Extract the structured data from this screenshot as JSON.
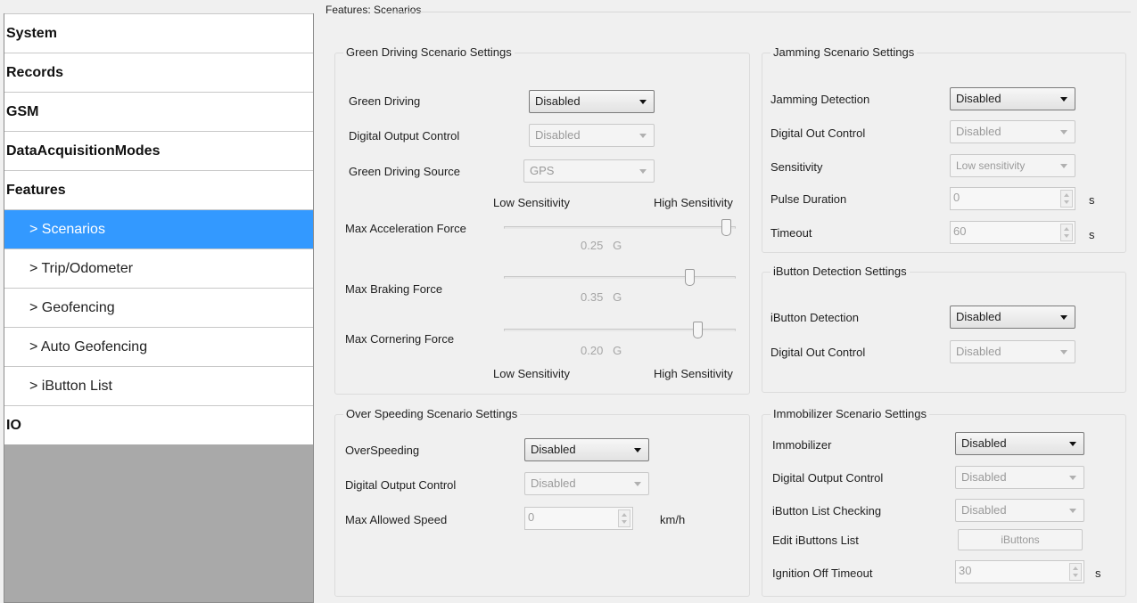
{
  "sidebar": {
    "items": [
      {
        "label": "System"
      },
      {
        "label": "Records"
      },
      {
        "label": "GSM"
      },
      {
        "label": "DataAcquisitionModes"
      },
      {
        "label": "Features"
      },
      {
        "label": "> Scenarios"
      },
      {
        "label": "> Trip/Odometer"
      },
      {
        "label": "> Geofencing"
      },
      {
        "label": "> Auto Geofencing"
      },
      {
        "label": "> iButton List"
      },
      {
        "label": "IO"
      }
    ],
    "selected": "> Scenarios"
  },
  "page": {
    "title": "Features: Scenarios"
  },
  "green": {
    "title": "Green Driving Scenario Settings",
    "green_driving": {
      "label": "Green Driving",
      "value": "Disabled"
    },
    "digital_output": {
      "label": "Digital Output Control",
      "value": "Disabled"
    },
    "source": {
      "label": "Green Driving Source",
      "value": "GPS"
    },
    "low_label": "Low Sensitivity",
    "high_label": "High Sensitivity",
    "accel": {
      "label": "Max Acceleration Force",
      "value": "0.25",
      "unit": "G",
      "level": 1.0
    },
    "braking": {
      "label": "Max Braking Force",
      "value": "0.35",
      "unit": "G",
      "level": 0.83
    },
    "cornering": {
      "label": "Max Cornering Force",
      "value": "0.20",
      "unit": "G",
      "level": 0.87
    }
  },
  "jamming": {
    "title": "Jamming Scenario Settings",
    "detection": {
      "label": "Jamming Detection",
      "value": "Disabled"
    },
    "digital_out": {
      "label": "Digital Out Control",
      "value": "Disabled"
    },
    "sensitivity": {
      "label": "Sensitivity",
      "value": "Low sensitivity"
    },
    "pulse": {
      "label": "Pulse Duration",
      "value": "0",
      "unit": "s"
    },
    "timeout": {
      "label": "Timeout",
      "value": "60",
      "unit": "s"
    }
  },
  "ibutton": {
    "title": "iButton Detection Settings",
    "detection": {
      "label": "iButton Detection",
      "value": "Disabled"
    },
    "digital_out": {
      "label": "Digital Out Control",
      "value": "Disabled"
    }
  },
  "overspeed": {
    "title": "Over Speeding Scenario Settings",
    "overspeeding": {
      "label": "OverSpeeding",
      "value": "Disabled"
    },
    "digital_output": {
      "label": "Digital Output Control",
      "value": "Disabled"
    },
    "max_speed": {
      "label": "Max Allowed Speed",
      "value": "0",
      "unit": "km/h"
    }
  },
  "immobilizer": {
    "title": "Immobilizer Scenario Settings",
    "immobilizer": {
      "label": "Immobilizer",
      "value": "Disabled"
    },
    "digital_output": {
      "label": "Digital Output Control",
      "value": "Disabled"
    },
    "list_checking": {
      "label": "iButton List Checking",
      "value": "Disabled"
    },
    "edit_list": {
      "label": "Edit iButtons List",
      "button": "iButtons"
    },
    "ignition_timeout": {
      "label": "Ignition Off Timeout",
      "value": "30",
      "unit": "s"
    }
  }
}
